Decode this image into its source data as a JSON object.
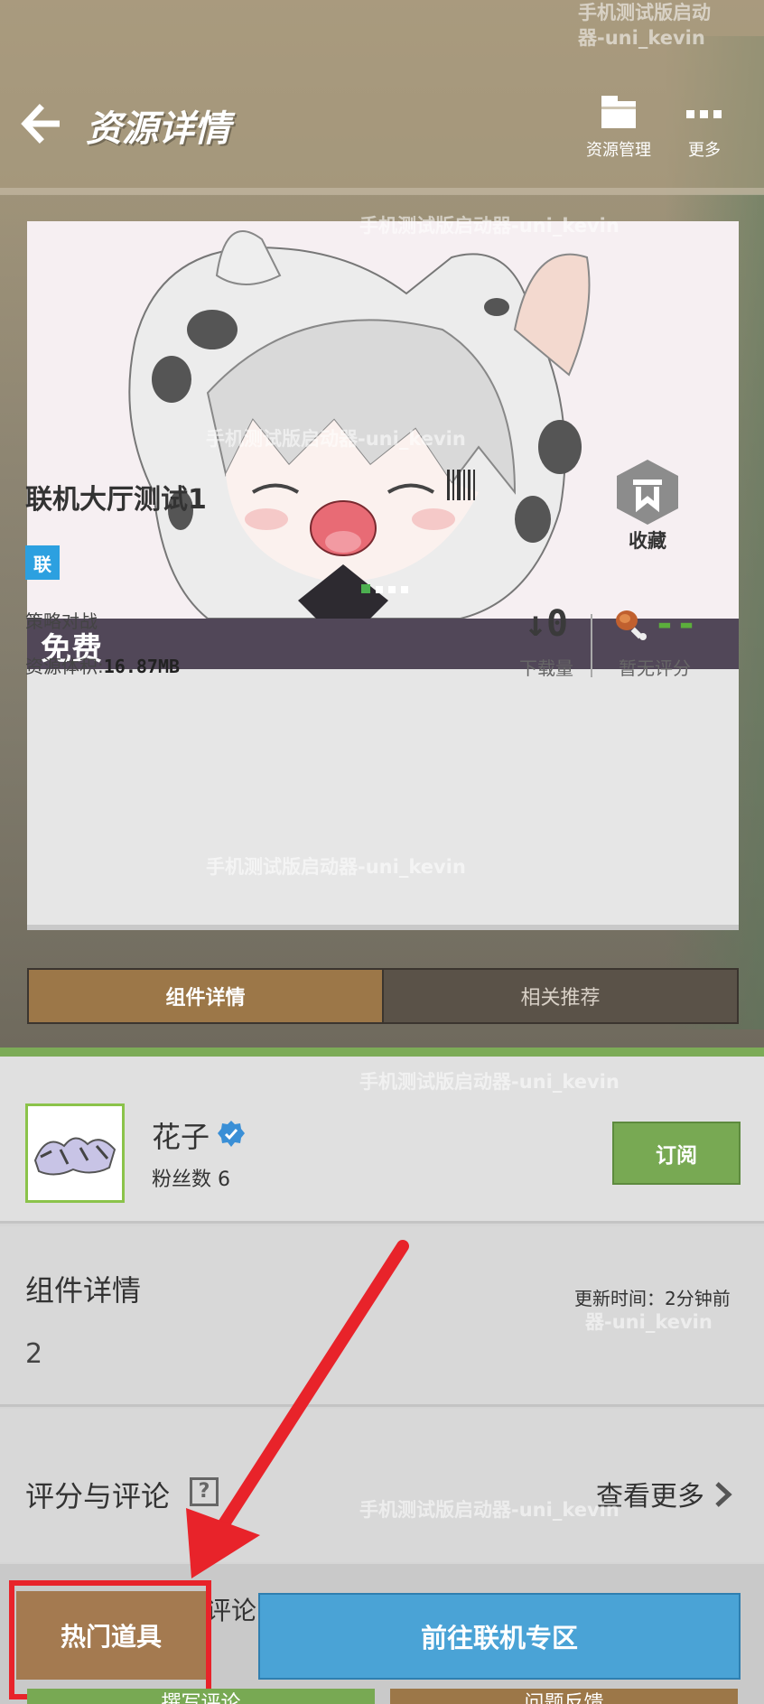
{
  "header": {
    "title": "资源详情",
    "actions": [
      {
        "label": "资源管理",
        "icon": "folder-icon"
      },
      {
        "label": "更多",
        "icon": "more-dots-icon"
      }
    ]
  },
  "watermark": {
    "line1": "手机测试版启动",
    "line2": "器-uni_kevin",
    "full": "手机测试版启动器-uni_kevin"
  },
  "resource": {
    "price": "免费",
    "title": "联机大厅测试1",
    "tag": "联",
    "category": "策略对战",
    "size_label": "资源体积:",
    "size_value": "16.87MB",
    "favorite_label": "收藏",
    "downloads_value": "↓0",
    "downloads_label": "下载量",
    "rating_value": "--",
    "rating_label": "暂无评分"
  },
  "tabs": [
    {
      "label": "组件详情",
      "active": true
    },
    {
      "label": "相关推荐",
      "active": false
    }
  ],
  "author": {
    "name": "花子",
    "fans": "粉丝数 6",
    "subscribe_label": "订阅"
  },
  "detail": {
    "title": "组件详情",
    "update_time": "更新时间：2分钟前",
    "body": "2"
  },
  "reviews": {
    "title": "评分与评论",
    "help": "?",
    "see_more": "查看更多"
  },
  "bottom": {
    "hot_items": "热门道具",
    "partial": "评论",
    "go_multiplayer": "前往联机专区",
    "peek_left": "撰写评论",
    "peek_right": "问题反馈"
  },
  "colors": {
    "price_bar": "#514758",
    "tag_blue": "#2ca0e0",
    "subscribe_green": "#78a953",
    "tab_active": "#9c7748",
    "go_blue": "#4aa3d6",
    "annotation_red": "#e8232a"
  }
}
